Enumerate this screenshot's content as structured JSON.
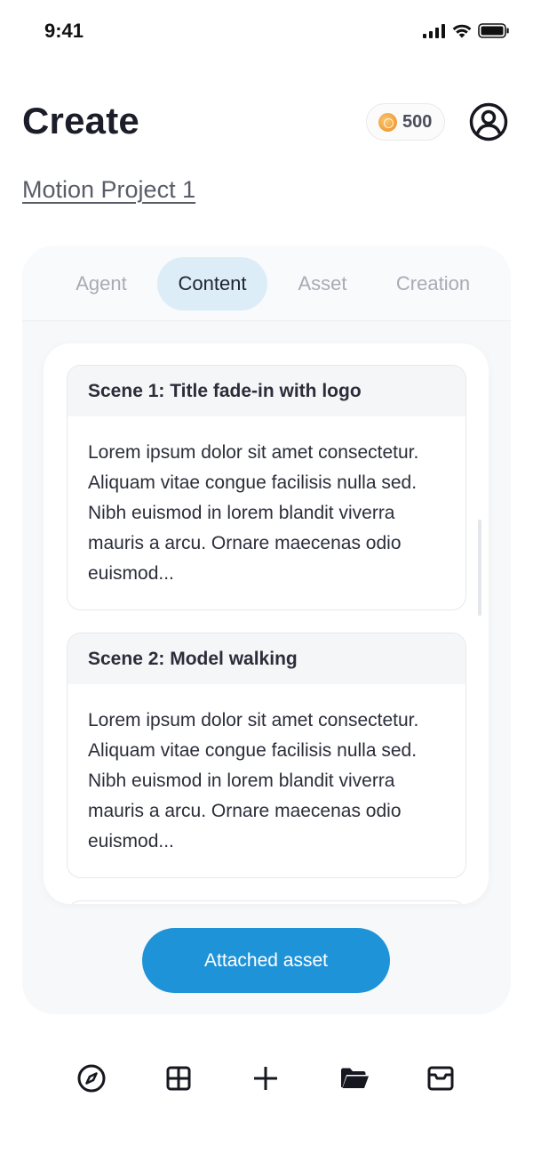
{
  "status_bar": {
    "time": "9:41"
  },
  "header": {
    "title": "Create",
    "coins": "500",
    "coin_icon": "coin-icon",
    "avatar_icon": "user-circle-icon"
  },
  "project": {
    "name": "Motion Project 1"
  },
  "tabs": [
    {
      "label": "Agent",
      "active": false
    },
    {
      "label": "Content",
      "active": true
    },
    {
      "label": "Asset",
      "active": false
    },
    {
      "label": "Creation",
      "active": false
    }
  ],
  "scenes": [
    {
      "title": "Scene 1: Title fade-in with logo",
      "body": "Lorem ipsum dolor sit amet consectetur. Aliquam vitae congue facilisis nulla sed. Nibh euismod in lorem blandit viverra mauris a arcu. Ornare maecenas odio euismod..."
    },
    {
      "title": "Scene 2: Model walking",
      "body": "Lorem ipsum dolor sit amet consectetur. Aliquam vitae congue facilisis nulla sed. Nibh euismod in lorem blandit viverra mauris a arcu. Ornare maecenas odio euismod..."
    }
  ],
  "actions": {
    "attached_asset": "Attached asset"
  },
  "bottom_nav": [
    {
      "icon": "compass-icon"
    },
    {
      "icon": "grid-icon"
    },
    {
      "icon": "plus-icon"
    },
    {
      "icon": "folder-icon"
    },
    {
      "icon": "archive-icon"
    }
  ],
  "colors": {
    "accent": "#1f93d8",
    "active_tab_bg": "#dcedf8",
    "panel_bg": "#f6f8fa"
  }
}
